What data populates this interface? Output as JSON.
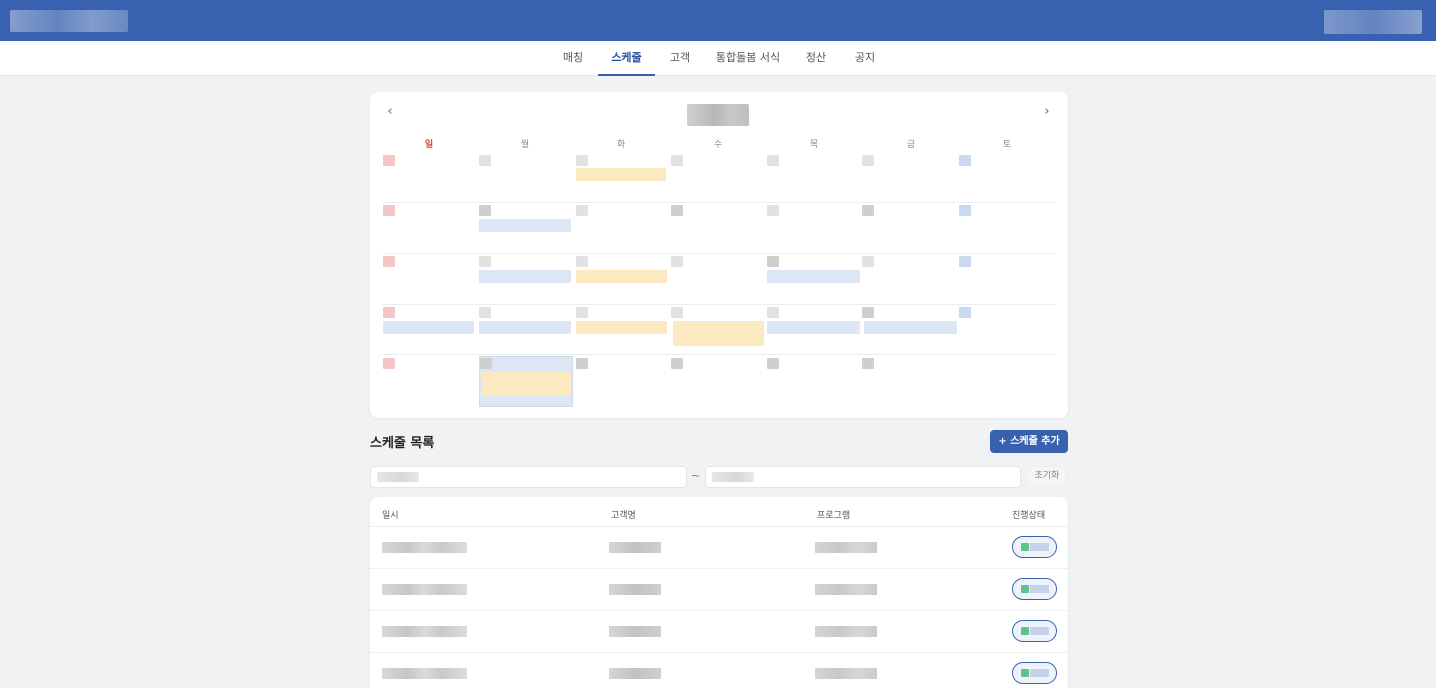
{
  "nav": {
    "items": [
      {
        "label": "매칭",
        "active": false
      },
      {
        "label": "스케줄",
        "active": true
      },
      {
        "label": "고객",
        "active": false
      },
      {
        "label": "통합돌봄 서식",
        "active": false
      },
      {
        "label": "정산",
        "active": false
      },
      {
        "label": "공지",
        "active": false
      }
    ]
  },
  "calendar": {
    "prev_icon": "‹",
    "next_icon": "›",
    "weekdays": [
      "일",
      "월",
      "화",
      "수",
      "목",
      "금",
      "토"
    ]
  },
  "schedule": {
    "title": "스케줄 목록",
    "add_button": "+ 스케줄 추가",
    "date_separator": "~",
    "reset_button": "초기화",
    "columns": [
      "일시",
      "고객명",
      "프로그램",
      "진행상태"
    ],
    "visible_row_count": 4
  },
  "colors": {
    "header_blue": "#3862b0",
    "sunday_red": "#d9453a",
    "event_yellow": "#fbeac0",
    "event_blue": "#dde6f5",
    "status_green": "#5fc28a"
  },
  "icons": {
    "prev_month": "chevron-left-icon",
    "next_month": "chevron-right-icon"
  }
}
